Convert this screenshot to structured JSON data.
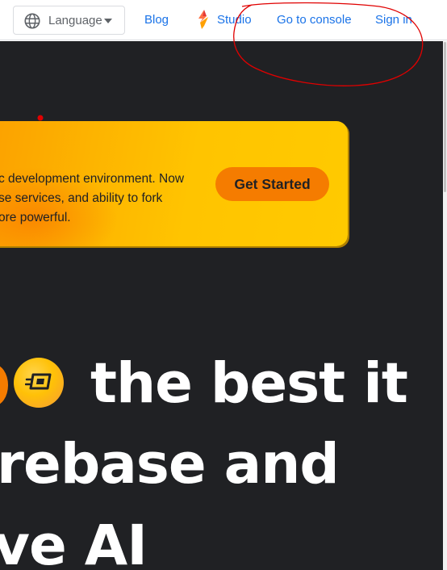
{
  "nav": {
    "language_label": "Language",
    "links": {
      "blog": "Blog",
      "studio": "Studio",
      "console": "Go to console",
      "signin": "Sign in"
    }
  },
  "banner": {
    "line1": "c development environment. Now",
    "line2": "se services, and ability to fork",
    "line3": "ore powerful.",
    "cta_label": "Get Started"
  },
  "headline": {
    "line1": "the best it",
    "line2": "rebase and",
    "line3": "ve AI"
  },
  "icons": {
    "language": "globe-icon",
    "language_dropdown": "caret-down-icon",
    "studio": "firebase-studio-icon",
    "speed_orb": "fast-forward-icon"
  },
  "colors": {
    "link": "#1a73e8",
    "hero_bg": "#202124",
    "banner_yellow": "#ffc400",
    "cta_orange": "#f57c00",
    "annotation_red": "#e00000"
  }
}
